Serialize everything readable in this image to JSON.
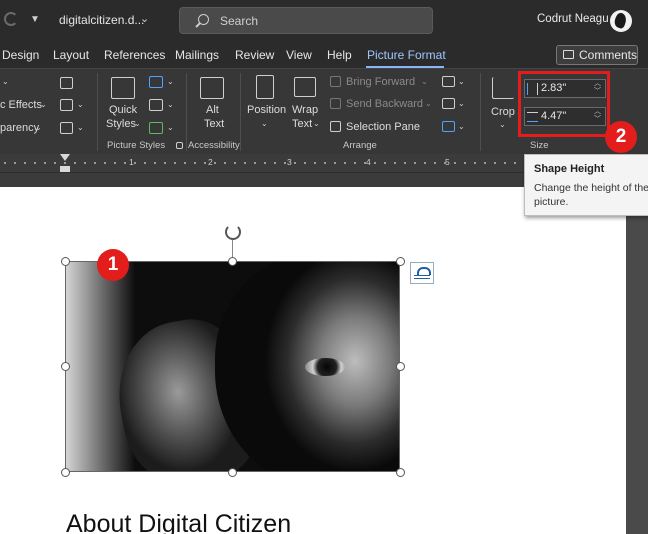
{
  "titlebar": {
    "file_name": "digitalcitizen.d...",
    "search_placeholder": "Search",
    "user_name": "Codrut Neagu"
  },
  "tabs": [
    {
      "label": "Design"
    },
    {
      "label": "Layout"
    },
    {
      "label": "References"
    },
    {
      "label": "Mailings"
    },
    {
      "label": "Review"
    },
    {
      "label": "View"
    },
    {
      "label": "Help"
    },
    {
      "label": "Picture Format",
      "active": true
    }
  ],
  "comments_label": "Comments",
  "ribbon": {
    "picture_effects": "c Effects",
    "transparency": "parency",
    "quick_styles": [
      "Quick",
      "Styles"
    ],
    "alt_text": [
      "Alt",
      "Text"
    ],
    "position": "Position",
    "wrap_text": [
      "Wrap",
      "Text"
    ],
    "bring_forward": "Bring Forward",
    "send_backward": "Send Backward",
    "selection_pane": "Selection Pane",
    "crop": "Crop",
    "height_value": "2.83\"",
    "width_value": "4.47\"",
    "groups": {
      "picture_styles": "Picture Styles",
      "accessibility": "Accessibility",
      "arrange": "Arrange",
      "size": "Size"
    }
  },
  "ruler": {
    "numbers": [
      "1",
      "2",
      "3",
      "4",
      "5",
      "6"
    ]
  },
  "badges": {
    "one": "1",
    "two": "2"
  },
  "tooltip": {
    "title": "Shape Height",
    "body": "Change the height of the picture."
  },
  "document": {
    "heading": "About Digital Citizen"
  },
  "colors": {
    "accent": "#8ab4f8",
    "callout": "#e31c1c"
  }
}
